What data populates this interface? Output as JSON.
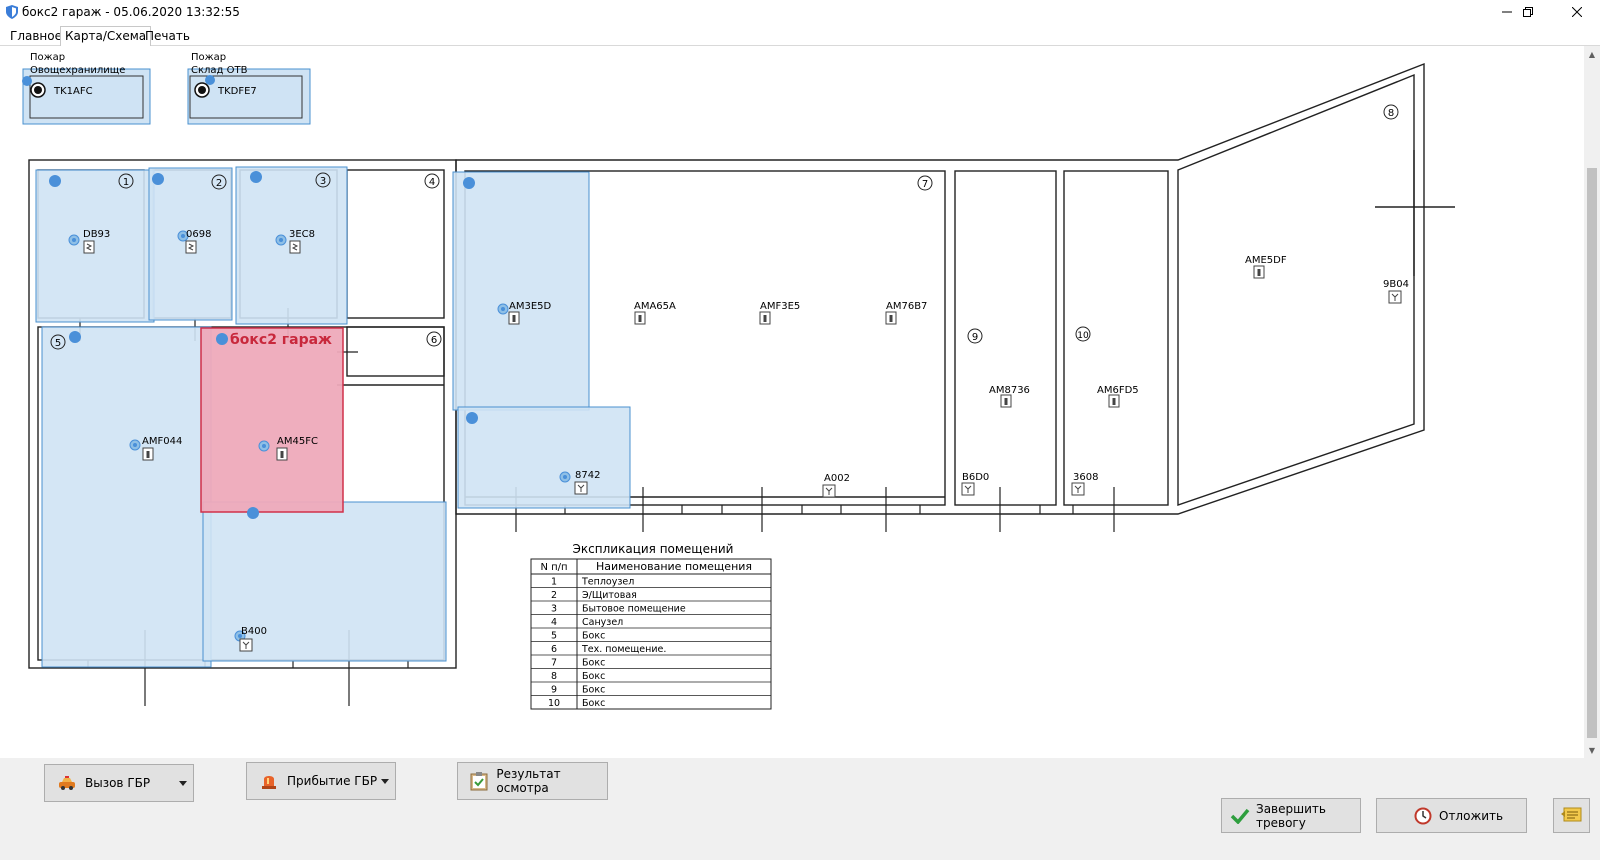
{
  "window": {
    "title": "бокс2 гараж - 05.06.2020 13:32:55",
    "controls": [
      "minimize",
      "restore",
      "close"
    ]
  },
  "tabs": [
    {
      "label": "Главное",
      "active": false
    },
    {
      "label": "Карта/Схема",
      "active": true
    },
    {
      "label": "Печать",
      "active": false
    }
  ],
  "fire_panels": [
    {
      "title_line1": "Пожар",
      "title_line2": "Овощехранилище",
      "device": "TK1AFC"
    },
    {
      "title_line1": "Пожар",
      "title_line2": "Склад ОТВ",
      "device": "TKDFE7"
    }
  ],
  "rooms": [
    "1",
    "2",
    "3",
    "4",
    "5",
    "6",
    "7",
    "8",
    "9",
    "10"
  ],
  "alarm_zone_label": "бокс2 гараж",
  "sensors": [
    {
      "id": "DB93",
      "type": "smoke"
    },
    {
      "id": "0698",
      "type": "smoke"
    },
    {
      "id": "3EC8",
      "type": "smoke"
    },
    {
      "id": "AMF044",
      "type": "motion"
    },
    {
      "id": "AM45FC",
      "type": "motion"
    },
    {
      "id": "B400",
      "type": "heat"
    },
    {
      "id": "AM3E5D",
      "type": "motion"
    },
    {
      "id": "AMA65A",
      "type": "motion"
    },
    {
      "id": "AMF3E5",
      "type": "motion"
    },
    {
      "id": "AM76B7",
      "type": "motion"
    },
    {
      "id": "8742",
      "type": "heat"
    },
    {
      "id": "A002",
      "type": "heat"
    },
    {
      "id": "AM8736",
      "type": "motion"
    },
    {
      "id": "AM6FD5",
      "type": "motion"
    },
    {
      "id": "B6D0",
      "type": "heat"
    },
    {
      "id": "3608",
      "type": "heat"
    },
    {
      "id": "AME5DF",
      "type": "motion"
    },
    {
      "id": "9B04",
      "type": "heat"
    }
  ],
  "explication": {
    "title": "Экспликация помещений",
    "headers": [
      "N п/п",
      "Наименование помещения"
    ],
    "rows": [
      [
        "1",
        "Теплоузел"
      ],
      [
        "2",
        "Э/Щитовая"
      ],
      [
        "3",
        "Бытовое помещение"
      ],
      [
        "4",
        "Санузел"
      ],
      [
        "5",
        "Бокс"
      ],
      [
        "6",
        "Тех. помещение."
      ],
      [
        "7",
        "Бокс"
      ],
      [
        "8",
        "Бокс"
      ],
      [
        "9",
        "Бокс"
      ],
      [
        "10",
        "Бокс"
      ]
    ]
  },
  "buttons": {
    "call_gbr": "Вызов ГБР",
    "arrival_gbr": "Прибытие ГБР",
    "inspection": "Результат осмотра",
    "finish_alarm": "Завершить тревогу",
    "postpone": "Отложить"
  },
  "colors": {
    "zone_fill": "#cfe3f4",
    "zone_stroke": "#4a90cf",
    "alarm_fill": "#eeaabb",
    "alarm_stroke": "#d0304a",
    "alarm_text": "#c8283c",
    "sensor_dot": "#4a90d9"
  }
}
